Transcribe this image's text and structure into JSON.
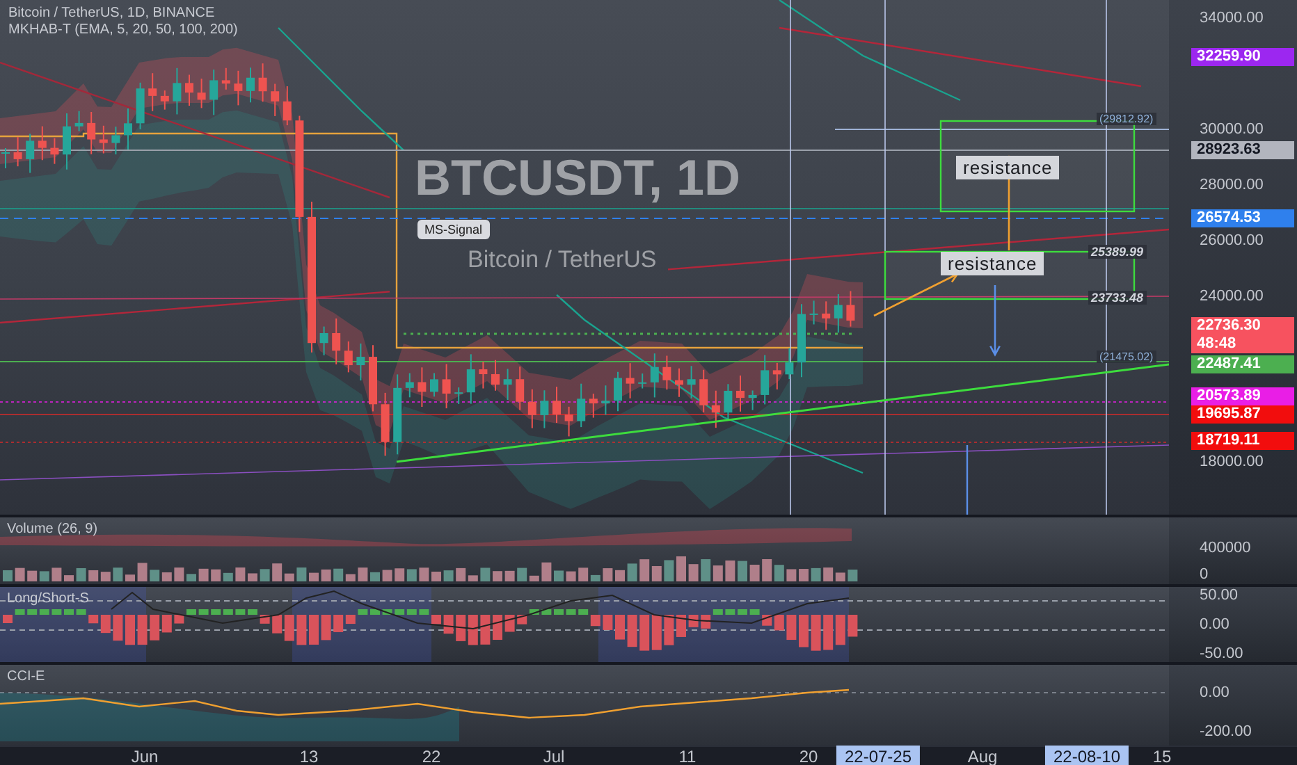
{
  "chart": {
    "symbol_line": "Bitcoin / TetherUS, 1D, BINANCE",
    "indicator_line": "MKHAB-T (EMA, 5, 20, 50, 100, 200)",
    "watermark_symbol": "BTCUSDT, 1D",
    "watermark_name": "Bitcoin / TetherUS",
    "signal_label": "MS-Signal",
    "annotations": [
      {
        "text": "resistance"
      },
      {
        "text": "resistance"
      }
    ],
    "level_labels": [
      "(29812.92)",
      "25389.99",
      "23733.48",
      "(21475.02)"
    ]
  },
  "price_axis": {
    "ticks": [
      "34000.00",
      "30000.00",
      "28000.00",
      "26000.00",
      "24000.00",
      "18000.00"
    ],
    "labels": [
      {
        "text": "32259.90",
        "color": "#9c27f0"
      },
      {
        "text": "28923.63",
        "color": "#b2b5be"
      },
      {
        "text": "26574.53",
        "color": "#2f80ed"
      },
      {
        "text": "22736.30",
        "countdown": "48:48",
        "color": "#f7525f"
      },
      {
        "text": "22487.41",
        "color": "#4caf50"
      },
      {
        "text": "20573.89",
        "color": "#e91ee6"
      },
      {
        "text": "19695.87",
        "color": "#f20d0d"
      },
      {
        "text": "18719.11",
        "color": "#f20d0d"
      }
    ]
  },
  "panes": [
    {
      "kind": "volume",
      "title": "Volume (26, 9)",
      "ticks": [
        "400000",
        "0"
      ]
    },
    {
      "kind": "oscillator",
      "title": "Long/Short-S",
      "ticks": [
        "50.00",
        "0.00",
        "-50.00"
      ]
    },
    {
      "kind": "cci",
      "title": "CCI-E",
      "ticks": [
        "0.00",
        "-200.00"
      ]
    }
  ],
  "time_axis": {
    "labels": [
      {
        "text": "Jun",
        "highlighted": false
      },
      {
        "text": "13",
        "highlighted": false
      },
      {
        "text": "22",
        "highlighted": false
      },
      {
        "text": "Jul",
        "highlighted": false
      },
      {
        "text": "11",
        "highlighted": false
      },
      {
        "text": "20",
        "highlighted": false
      },
      {
        "text": "22-07-25",
        "highlighted": true
      },
      {
        "text": "Aug",
        "highlighted": false
      },
      {
        "text": "22-08-10",
        "highlighted": true
      },
      {
        "text": "15",
        "highlighted": false
      }
    ]
  }
}
